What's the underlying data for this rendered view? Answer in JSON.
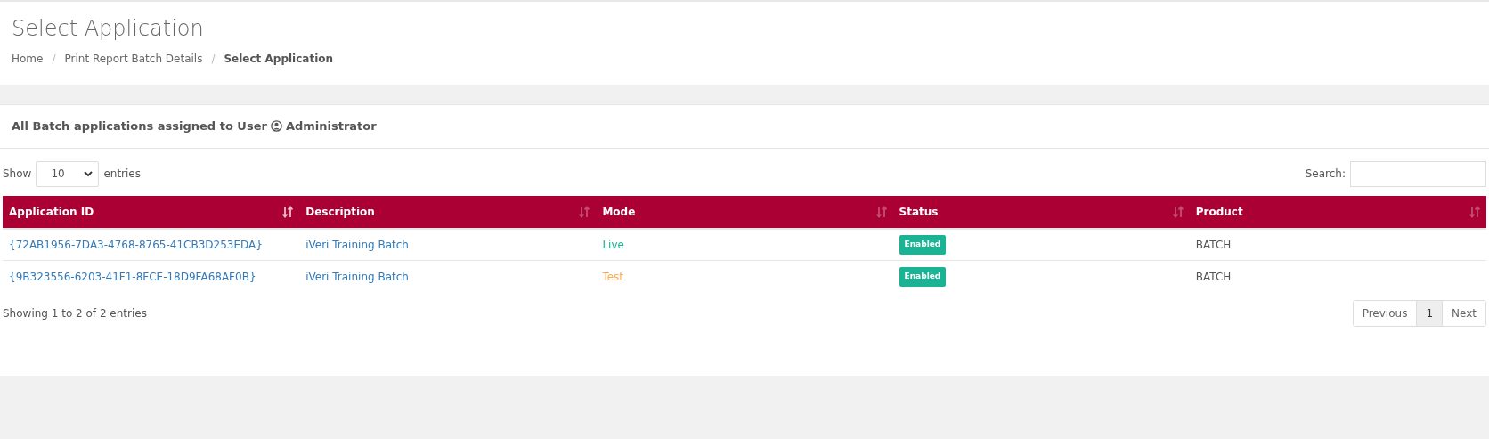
{
  "page_title": "Select Application",
  "breadcrumb_separator": "/",
  "breadcrumb": [
    {
      "label": "Home",
      "selected": false
    },
    {
      "label": "Print Report Batch Details",
      "selected": false
    },
    {
      "label": "Select Application",
      "selected": true
    }
  ],
  "panel": {
    "heading_prefix": "All Batch applications assigned to User",
    "user": "Administrator"
  },
  "length_menu": {
    "before": "Show",
    "value": "10",
    "after": "entries"
  },
  "search": {
    "label": "Search:"
  },
  "table": {
    "columns": [
      {
        "label": "Application ID",
        "sorted": true
      },
      {
        "label": "Description",
        "sorted": false
      },
      {
        "label": "Mode",
        "sorted": false
      },
      {
        "label": "Status",
        "sorted": false
      },
      {
        "label": "Product",
        "sorted": false
      }
    ],
    "rows": [
      {
        "id": "{72AB1956-7DA3-4768-8765-41CB3D253EDA}",
        "description": "iVeri Training Batch",
        "mode": "Live",
        "color": "#1bb394",
        "status": "Enabled",
        "product": "BATCH"
      },
      {
        "id": "{9B323556-6203-41F1-8FCE-18D9FA68AF0B}",
        "description": "iVeri Training Batch",
        "mode": "Test",
        "color": "#f8ac59",
        "status": "Enabled",
        "product": "BATCH"
      }
    ]
  },
  "info": "Showing 1 to 2 of 2 entries",
  "pagination": [
    {
      "label": "Previous",
      "selected": false
    },
    {
      "label": "1",
      "selected": true
    },
    {
      "label": "Next",
      "selected": false
    }
  ]
}
